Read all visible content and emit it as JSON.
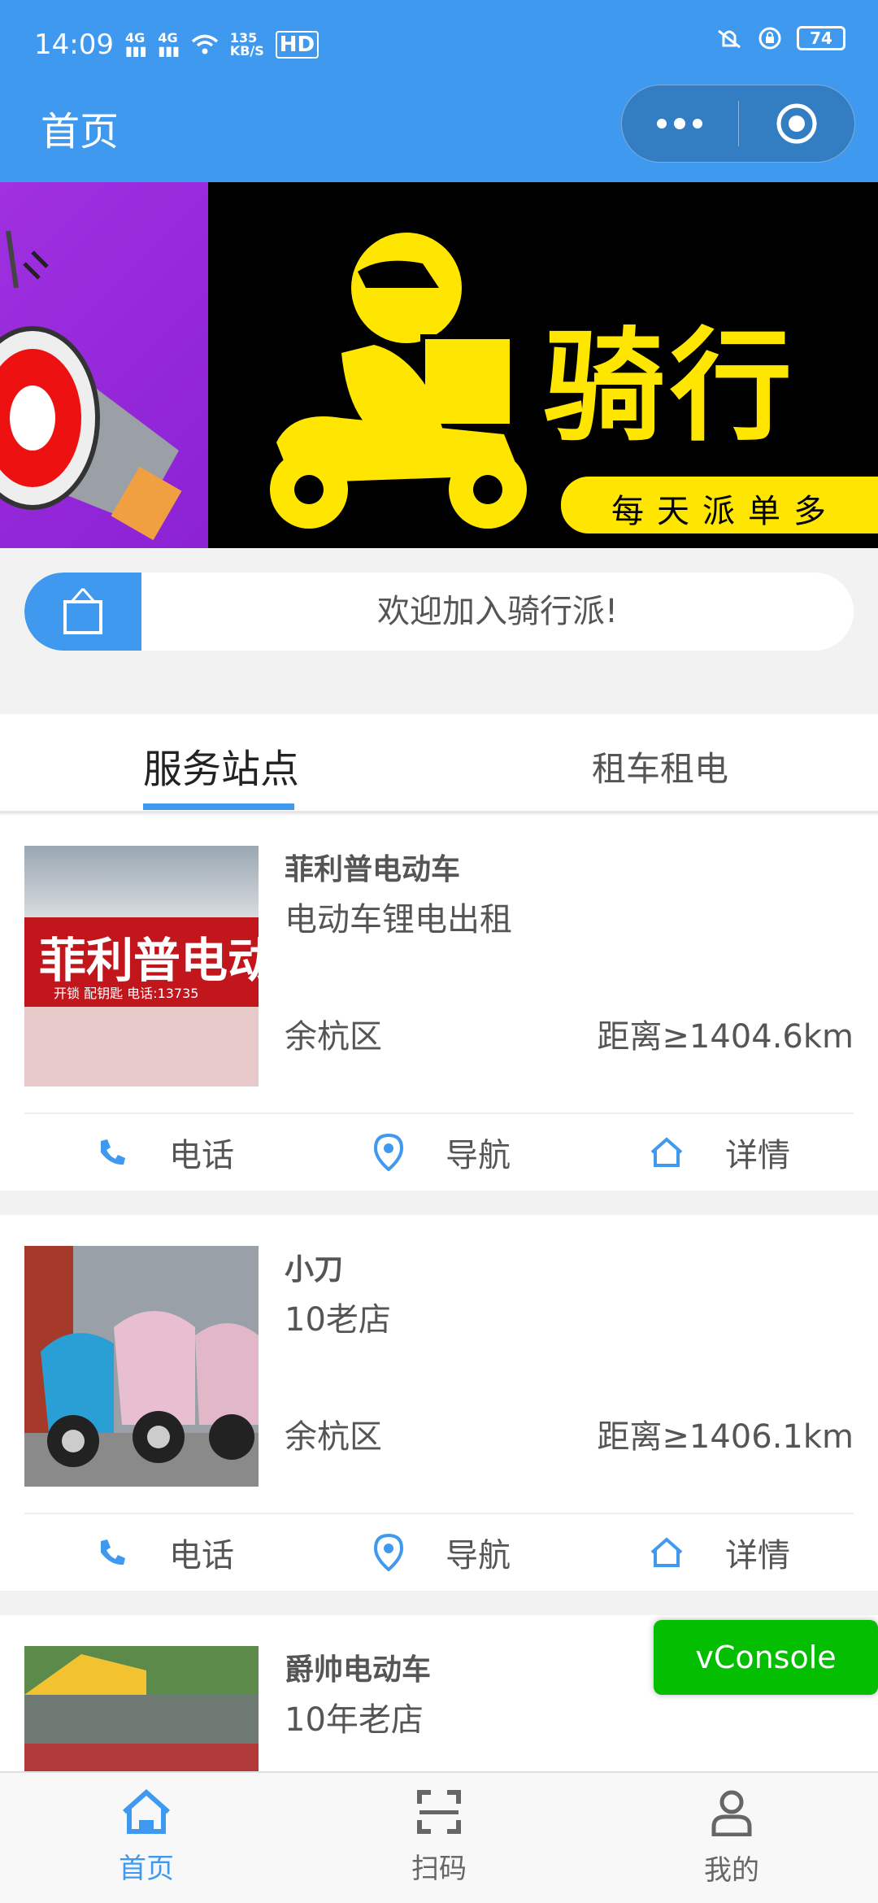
{
  "status": {
    "time": "14:09",
    "signal1": "4G",
    "signal2": "4G",
    "speed_value": "135",
    "speed_unit": "KB/S",
    "hd": "HD",
    "battery": "74"
  },
  "header": {
    "title": "首页"
  },
  "banner": {
    "title": "骑行",
    "subtitle": "每天派单多"
  },
  "notice": {
    "text": "欢迎加入骑行派!"
  },
  "tabs": [
    {
      "label": "服务站点",
      "active": true
    },
    {
      "label": "租车租电",
      "active": false
    }
  ],
  "stations": [
    {
      "name": "菲利普电动车",
      "desc": "电动车锂电出租",
      "area": "余杭区",
      "distance": "距离≥1404.6km",
      "sign_text": "菲利普电动",
      "sign_sub": "开锁 配钥匙  电话:13735"
    },
    {
      "name": "小刀",
      "desc": "10老店",
      "area": "余杭区",
      "distance": "距离≥1406.1km"
    },
    {
      "name": "爵帅电动车",
      "desc": "10年老店"
    }
  ],
  "actions": {
    "call": "电话",
    "navigate": "导航",
    "details": "详情"
  },
  "vconsole": {
    "label": "vConsole"
  },
  "bottom_nav": [
    {
      "label": "首页",
      "icon": "home-icon"
    },
    {
      "label": "扫码",
      "icon": "scan-icon"
    },
    {
      "label": "我的",
      "icon": "user-icon"
    }
  ],
  "colors": {
    "primary": "#3f99ee",
    "vconsole": "#04be02"
  }
}
